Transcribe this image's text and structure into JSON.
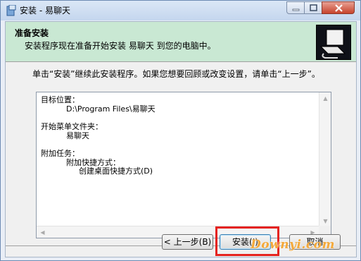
{
  "window": {
    "title": "安装 - 易聊天"
  },
  "header": {
    "title": "准备安装",
    "subtitle": "安装程序现在准备开始安装 易聊天 到您的电脑中。"
  },
  "intro": "单击“安装”继续此安装程序。如果您想要回顾或改变设置，请单击“上一步”。",
  "memo": {
    "l1": "目标位置：",
    "l2": "D:\\Program Files\\易聊天",
    "l3": "开始菜单文件夹：",
    "l4": "易聊天",
    "l5": "附加任务：",
    "l6": "附加快捷方式：",
    "l7": "创建桌面快捷方式(D)"
  },
  "buttons": {
    "back": "< 上一步(B)",
    "install": "安装(I)",
    "cancel": "取消"
  },
  "watermark": "Downyi.com",
  "colors": {
    "header_bg": "#c9e8d3",
    "highlight": "#e5231f",
    "watermark": "#f4a93a"
  }
}
